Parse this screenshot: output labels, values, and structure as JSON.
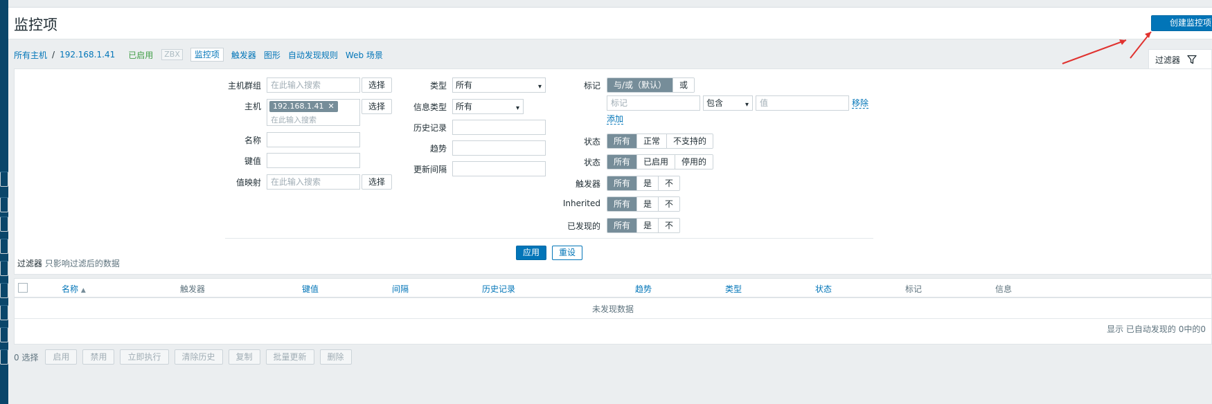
{
  "header": {
    "title": "监控项",
    "create_button": "创建监控项"
  },
  "breadcrumb": {
    "all_hosts": "所有主机",
    "separator": "/",
    "host": "192.168.1.41",
    "status": "已启用",
    "zbx": "ZBX",
    "tabs": [
      "监控项",
      "触发器",
      "图形",
      "自动发现规则",
      "Web 场景"
    ]
  },
  "filter_tab": {
    "label": "过滤器",
    "icon": "funnel-icon"
  },
  "filter": {
    "host_groups": {
      "label": "主机群组",
      "placeholder": "在此输入搜索",
      "select": "选择"
    },
    "hosts": {
      "label": "主机",
      "chip": "192.168.1.41",
      "placeholder": "在此输入搜索",
      "select": "选择"
    },
    "name": {
      "label": "名称",
      "value": ""
    },
    "key": {
      "label": "键值",
      "value": ""
    },
    "value_mapping": {
      "label": "值映射",
      "placeholder": "在此输入搜索",
      "select": "选择"
    },
    "type": {
      "label": "类型",
      "value": "所有"
    },
    "info_type": {
      "label": "信息类型",
      "value": "所有"
    },
    "history": {
      "label": "历史记录",
      "value": ""
    },
    "trends": {
      "label": "趋势",
      "value": ""
    },
    "update_interval": {
      "label": "更新间隔",
      "value": ""
    },
    "tags": {
      "label": "标记",
      "mode_options": [
        "与/或（默认）",
        "或"
      ],
      "tag_placeholder": "标记",
      "operator": "包含",
      "value_placeholder": "值",
      "remove": "移除",
      "add": "添加"
    },
    "state": {
      "label": "状态",
      "options": [
        "所有",
        "正常",
        "不支持的"
      ]
    },
    "status": {
      "label": "状态",
      "options": [
        "所有",
        "已启用",
        "停用的"
      ]
    },
    "triggers": {
      "label": "触发器",
      "options": [
        "所有",
        "是",
        "不"
      ]
    },
    "inherited": {
      "label": "Inherited",
      "options": [
        "所有",
        "是",
        "不"
      ]
    },
    "discovered": {
      "label": "已发现的",
      "options": [
        "所有",
        "是",
        "不"
      ]
    },
    "apply": "应用",
    "reset": "重设"
  },
  "filter_note": {
    "bold": "过滤器",
    "text": "只影响过滤后的数据"
  },
  "table": {
    "columns": [
      "名称",
      "触发器",
      "键值",
      "间隔",
      "历史记录",
      "趋势",
      "类型",
      "状态",
      "标记",
      "信息"
    ],
    "sort_indicator": "▲",
    "empty": "未发现数据",
    "footer": "显示 已自动发现的 0中的0"
  },
  "actions": {
    "selected": "0 选择",
    "buttons": [
      "启用",
      "禁用",
      "立即执行",
      "清除历史",
      "复制",
      "批量更新",
      "删除"
    ]
  },
  "colors": {
    "primary": "#0275b8",
    "enabled_green": "#429e47",
    "segment_active": "#768d99",
    "annotation_red": "#e0322f"
  }
}
